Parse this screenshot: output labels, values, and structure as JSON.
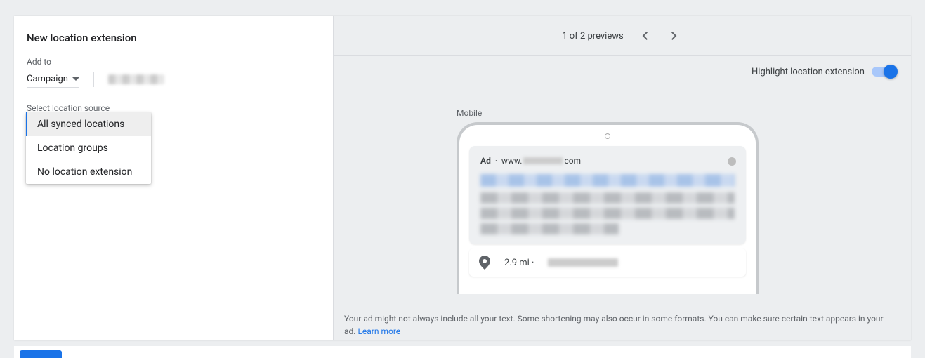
{
  "panel": {
    "title": "New location extension",
    "addto_label": "Add to",
    "level_label": "Campaign",
    "source_label": "Select location source"
  },
  "dropdown": {
    "options": [
      "All synced locations",
      "Location groups",
      "No location extension"
    ]
  },
  "preview": {
    "counter": "1 of 2 previews",
    "highlight_label": "Highlight location extension",
    "device_label": "Mobile",
    "ad_badge": "Ad",
    "ad_url_prefix": "www.",
    "ad_url_suffix": "com",
    "distance": "2.9 mi",
    "disclaimer_text": "Your ad might not always include all your text. Some shortening may also occur in some formats. You can make sure certain text appears in your ad. ",
    "learn_more": "Learn more"
  }
}
